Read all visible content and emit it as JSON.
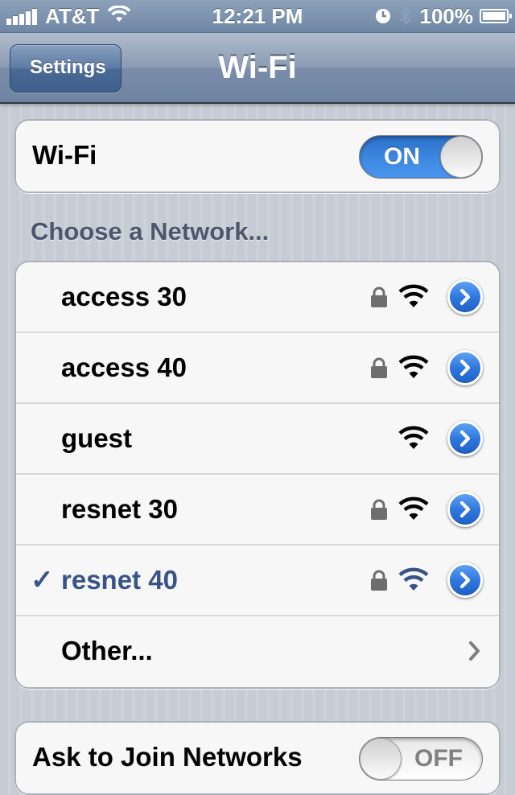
{
  "status_bar": {
    "carrier": "AT&T",
    "time": "12:21 PM",
    "battery": "100%",
    "battery_level": 1.0,
    "signal_bars": 5
  },
  "nav": {
    "back_label": "Settings",
    "title": "Wi-Fi"
  },
  "wifi_toggle": {
    "label": "Wi-Fi",
    "state": "ON"
  },
  "networks_section": {
    "header": "Choose a Network...",
    "networks": [
      {
        "name": "access 30",
        "locked": true,
        "selected": false
      },
      {
        "name": "access 40",
        "locked": true,
        "selected": false
      },
      {
        "name": "guest",
        "locked": false,
        "selected": false
      },
      {
        "name": "resnet 30",
        "locked": true,
        "selected": false
      },
      {
        "name": "resnet 40",
        "locked": true,
        "selected": true
      }
    ],
    "other_label": "Other...",
    "checkmark": "✓"
  },
  "ask_to_join": {
    "label": "Ask to Join Networks",
    "state": "OFF"
  },
  "colors": {
    "selected_text": "#385487",
    "toggle_on": "#3c86e0",
    "disclosure_blue": "#2f78de"
  }
}
